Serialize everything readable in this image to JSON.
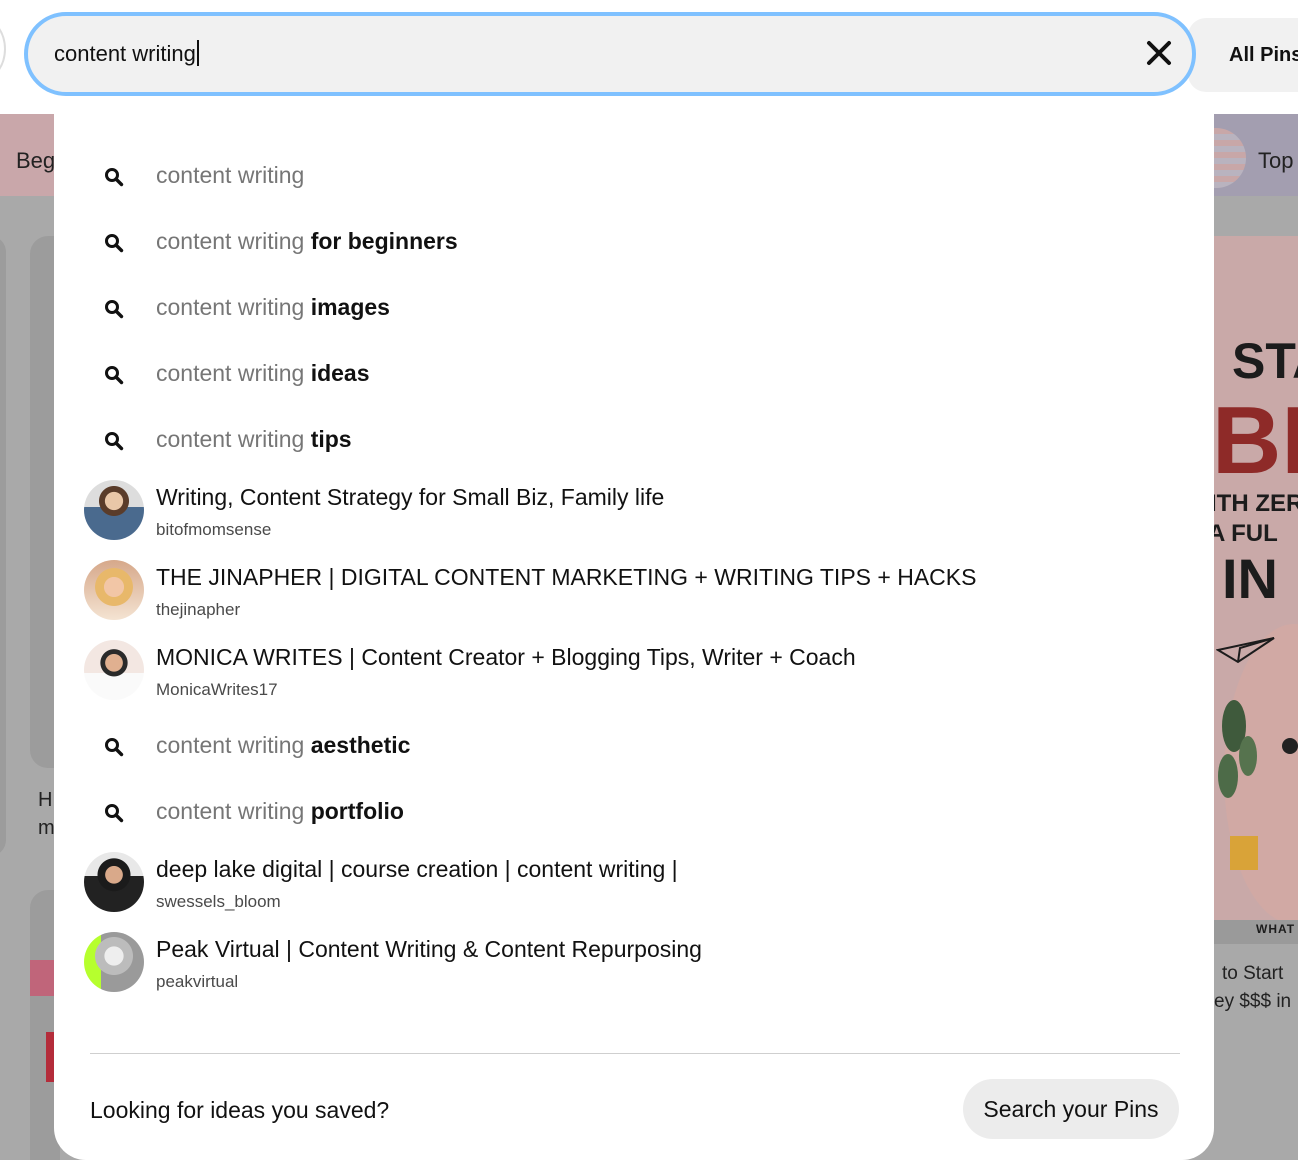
{
  "search": {
    "value": "content writing"
  },
  "header": {
    "all_pins_label": "All Pins"
  },
  "background": {
    "left_chip_label": "Beg",
    "right_chip_label": "Top",
    "left_card_text": [
      "H",
      "m"
    ],
    "right_card_text": [
      "to Start",
      "ey $$$ in"
    ],
    "right_card_words": [
      "STA",
      "BL",
      "ITH ZER",
      "A FUL",
      "IN",
      "WHAT"
    ]
  },
  "dropdown": {
    "query_base": "content writing",
    "items": [
      {
        "type": "query",
        "completion": ""
      },
      {
        "type": "query",
        "completion": "for beginners"
      },
      {
        "type": "query",
        "completion": "images"
      },
      {
        "type": "query",
        "completion": "ideas"
      },
      {
        "type": "query",
        "completion": "tips"
      },
      {
        "type": "profile",
        "title": "Writing, Content Strategy for Small Biz, Family life",
        "username": "bitofmomsense"
      },
      {
        "type": "profile",
        "title": "THE JINAPHER | DIGITAL CONTENT MARKETING + WRITING TIPS + HACKS",
        "username": "thejinapher"
      },
      {
        "type": "profile",
        "title": "MONICA WRITES | Content Creator + Blogging Tips, Writer + Coach",
        "username": "MonicaWrites17"
      },
      {
        "type": "query",
        "completion": "aesthetic"
      },
      {
        "type": "query",
        "completion": "portfolio"
      },
      {
        "type": "profile",
        "title": "deep lake digital | course creation | content writing |",
        "username": "swessels_bloom"
      },
      {
        "type": "profile",
        "title": "Peak Virtual | Content Writing & Content Repurposing",
        "username": "peakvirtual"
      }
    ],
    "footer": {
      "prompt": "Looking for ideas you saved?",
      "button_label": "Search your Pins"
    }
  },
  "colors": {
    "focus_ring": "#7fc1ff",
    "query_base_text": "#767676",
    "overlay_dim": "#a9a9a9"
  }
}
